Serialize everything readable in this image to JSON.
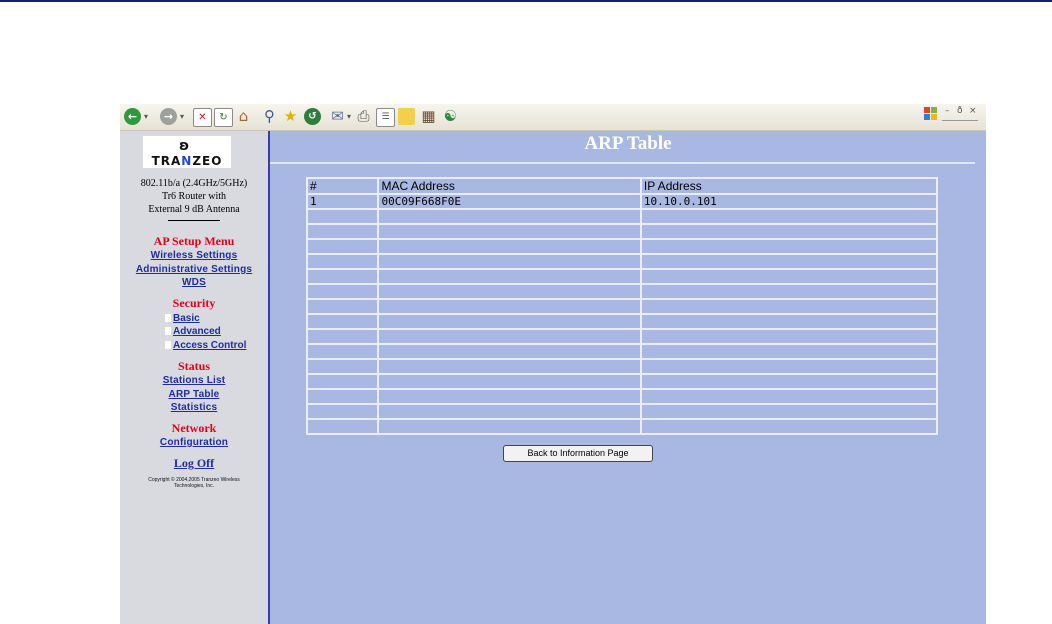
{
  "toolbar": {
    "icons": [
      "back-icon",
      "forward-icon",
      "stop-icon",
      "refresh-icon",
      "home-icon",
      "search-icon",
      "favorites-icon",
      "history-icon",
      "mail-icon",
      "print-icon",
      "edit-icon",
      "discuss-icon",
      "research-icon",
      "messenger-icon"
    ],
    "window_controls": {
      "minimize": "–",
      "restore": "ð",
      "close": "×"
    }
  },
  "sidebar": {
    "logo": {
      "mark": "ʚ",
      "text_left": "TRA",
      "text_mid": "N",
      "text_right": "ZEO"
    },
    "product_line1": "802.11b/a (2.4GHz/5GHz)",
    "product_line2": "Tr6 Router with",
    "product_line3": "External 9 dB Antenna",
    "ap_setup": {
      "heading": "AP Setup Menu",
      "links": [
        "Wireless Settings",
        "Administrative Settings",
        "WDS"
      ]
    },
    "security": {
      "heading": "Security",
      "links": [
        "Basic",
        "Advanced",
        "Access Control"
      ]
    },
    "status": {
      "heading": "Status",
      "links": [
        "Stations List",
        "ARP Table",
        "Statistics"
      ]
    },
    "network": {
      "heading": "Network",
      "links": [
        "Configuration"
      ]
    },
    "logoff": "Log Off",
    "copyright_line1": "Copyright © 2004,2005 Tranzeo Wireless",
    "copyright_line2": "Technologies, Inc."
  },
  "main": {
    "title": "ARP Table",
    "table": {
      "headers": [
        "#",
        "MAC Address",
        "IP Address"
      ],
      "rows": [
        [
          "1",
          "00C09F668F0E",
          "10.10.0.101"
        ],
        [
          "",
          "",
          ""
        ],
        [
          "",
          "",
          ""
        ],
        [
          "",
          "",
          ""
        ],
        [
          "",
          "",
          ""
        ],
        [
          "",
          "",
          ""
        ],
        [
          "",
          "",
          ""
        ],
        [
          "",
          "",
          ""
        ],
        [
          "",
          "",
          ""
        ],
        [
          "",
          "",
          ""
        ],
        [
          "",
          "",
          ""
        ],
        [
          "",
          "",
          ""
        ],
        [
          "",
          "",
          ""
        ],
        [
          "",
          "",
          ""
        ],
        [
          "",
          "",
          ""
        ],
        [
          "",
          "",
          ""
        ]
      ]
    },
    "back_button": "Back to Information Page"
  },
  "colors": {
    "content_bg": "#a8b8e2",
    "sidebar_bg": "#d9d9e0",
    "heading_red": "#e0001a",
    "link_blue": "#1e2ea0"
  }
}
